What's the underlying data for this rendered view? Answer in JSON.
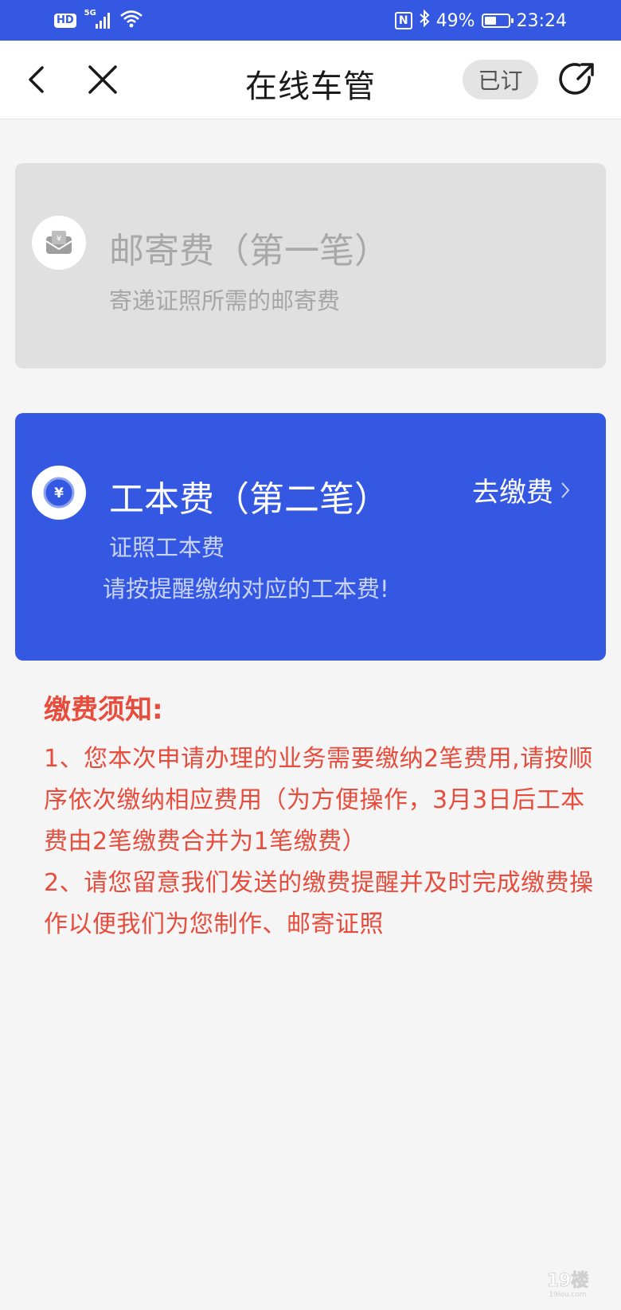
{
  "status_bar": {
    "hd": "HD",
    "network": "5G",
    "battery_percent": "49%",
    "battery_level": 0.49,
    "time": "23:24",
    "nfc": "N"
  },
  "nav": {
    "title": "在线车管",
    "subscribed_label": "已订"
  },
  "cards": [
    {
      "title": "邮寄费（第一笔）",
      "description": "寄递证照所需的邮寄费",
      "icon": "mailbox-icon",
      "state": "disabled"
    },
    {
      "title": "工本费（第二笔）",
      "description": "证照工本费",
      "reminder": "请按提醒缴纳对应的工本费!",
      "action_label": "去缴费",
      "icon": "yuan-icon",
      "state": "active"
    }
  ],
  "notice": {
    "title": "缴费须知:",
    "items": [
      "1、您本次申请办理的业务需要缴纳2笔费用,请按顺序依次缴纳相应费用（为方便操作，3月3日后工本费由2笔缴费合并为1笔缴费）",
      "2、请您留意我们发送的缴费提醒并及时完成缴费操作以便我们为您制作、邮寄证照"
    ]
  },
  "watermark": {
    "logo": "19楼",
    "site": "19lou.com"
  },
  "colors": {
    "brand_blue": "#3558e3",
    "notice_red": "#e74c3c",
    "disabled_card": "#e0e0e0",
    "page_bg": "#f5f5f5"
  }
}
